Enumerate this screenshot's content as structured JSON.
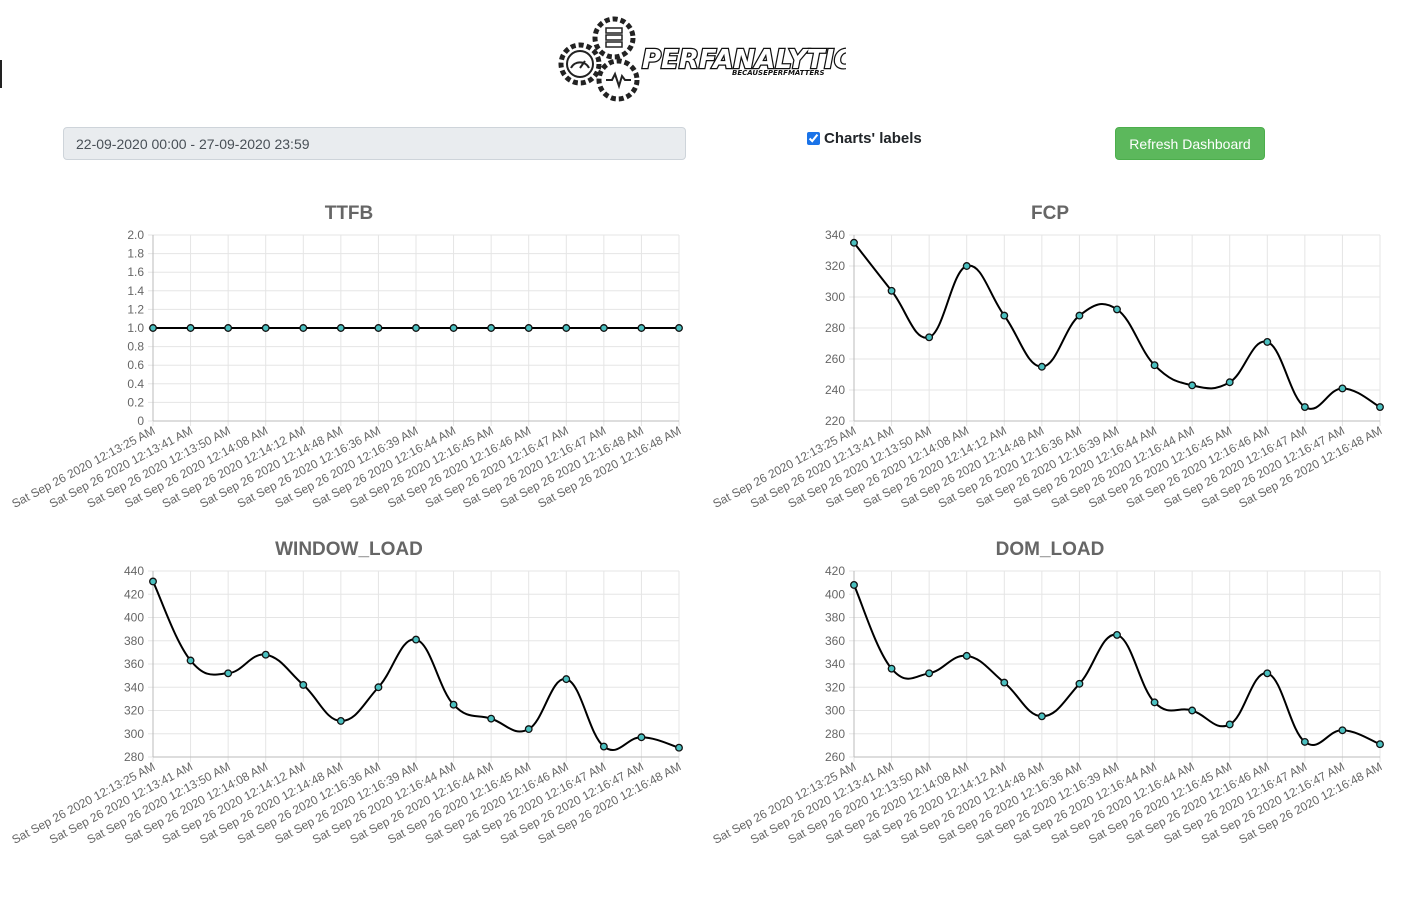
{
  "header": {
    "logo_text": "PERFANALYTICS",
    "logo_tagline": "BECAUSEPERFMATTERS"
  },
  "controls": {
    "date_range_value": "22-09-2020 00:00 - 27-09-2020 23:59",
    "labels_checkbox_label": "Charts' labels",
    "labels_checkbox_checked": true,
    "refresh_label": "Refresh Dashboard"
  },
  "colors": {
    "line": "#000000",
    "point_fill": "#4bc0c0",
    "grid": "#e5e5e5",
    "button_bg": "#5cb85c"
  },
  "chart_data": [
    {
      "type": "line",
      "title": "TTFB",
      "categories": [
        "Sat Sep 26 2020 12:13:25 AM",
        "Sat Sep 26 2020 12:13:41 AM",
        "Sat Sep 26 2020 12:13:50 AM",
        "Sat Sep 26 2020 12:14:08 AM",
        "Sat Sep 26 2020 12:14:12 AM",
        "Sat Sep 26 2020 12:14:48 AM",
        "Sat Sep 26 2020 12:16:36 AM",
        "Sat Sep 26 2020 12:16:39 AM",
        "Sat Sep 26 2020 12:16:44 AM",
        "Sat Sep 26 2020 12:16:45 AM",
        "Sat Sep 26 2020 12:16:46 AM",
        "Sat Sep 26 2020 12:16:47 AM",
        "Sat Sep 26 2020 12:16:47 AM",
        "Sat Sep 26 2020 12:16:48 AM",
        "Sat Sep 26 2020 12:16:48 AM"
      ],
      "values": [
        1,
        1,
        1,
        1,
        1,
        1,
        1,
        1,
        1,
        1,
        1,
        1,
        1,
        1,
        1
      ],
      "ylim": [
        0,
        2
      ],
      "yticks": [
        "0",
        "0.2",
        "0.4",
        "0.6",
        "0.8",
        "1.0",
        "1.2",
        "1.4",
        "1.6",
        "1.8",
        "2.0"
      ],
      "grid": true,
      "smooth": false
    },
    {
      "type": "line",
      "title": "FCP",
      "categories": [
        "Sat Sep 26 2020 12:13:25 AM",
        "Sat Sep 26 2020 12:13:41 AM",
        "Sat Sep 26 2020 12:13:50 AM",
        "Sat Sep 26 2020 12:14:08 AM",
        "Sat Sep 26 2020 12:14:12 AM",
        "Sat Sep 26 2020 12:14:48 AM",
        "Sat Sep 26 2020 12:16:36 AM",
        "Sat Sep 26 2020 12:16:39 AM",
        "Sat Sep 26 2020 12:16:44 AM",
        "Sat Sep 26 2020 12:16:44 AM",
        "Sat Sep 26 2020 12:16:45 AM",
        "Sat Sep 26 2020 12:16:46 AM",
        "Sat Sep 26 2020 12:16:47 AM",
        "Sat Sep 26 2020 12:16:47 AM",
        "Sat Sep 26 2020 12:16:48 AM"
      ],
      "values": [
        335,
        304,
        274,
        320,
        288,
        255,
        288,
        292,
        256,
        243,
        245,
        271,
        229,
        241,
        229
      ],
      "ylim": [
        220,
        340
      ],
      "yticks": [
        "220",
        "240",
        "260",
        "280",
        "300",
        "320",
        "340"
      ],
      "grid": true,
      "smooth": true
    },
    {
      "type": "line",
      "title": "WINDOW_LOAD",
      "categories": [
        "Sat Sep 26 2020 12:13:25 AM",
        "Sat Sep 26 2020 12:13:41 AM",
        "Sat Sep 26 2020 12:13:50 AM",
        "Sat Sep 26 2020 12:14:08 AM",
        "Sat Sep 26 2020 12:14:12 AM",
        "Sat Sep 26 2020 12:14:48 AM",
        "Sat Sep 26 2020 12:16:36 AM",
        "Sat Sep 26 2020 12:16:39 AM",
        "Sat Sep 26 2020 12:16:44 AM",
        "Sat Sep 26 2020 12:16:44 AM",
        "Sat Sep 26 2020 12:16:45 AM",
        "Sat Sep 26 2020 12:16:46 AM",
        "Sat Sep 26 2020 12:16:47 AM",
        "Sat Sep 26 2020 12:16:47 AM",
        "Sat Sep 26 2020 12:16:48 AM"
      ],
      "values": [
        431,
        363,
        352,
        368,
        342,
        311,
        340,
        381,
        325,
        313,
        304,
        347,
        289,
        297,
        288
      ],
      "ylim": [
        280,
        440
      ],
      "yticks": [
        "280",
        "300",
        "320",
        "340",
        "360",
        "380",
        "400",
        "420",
        "440"
      ],
      "grid": true,
      "smooth": true
    },
    {
      "type": "line",
      "title": "DOM_LOAD",
      "categories": [
        "Sat Sep 26 2020 12:13:25 AM",
        "Sat Sep 26 2020 12:13:41 AM",
        "Sat Sep 26 2020 12:13:50 AM",
        "Sat Sep 26 2020 12:14:08 AM",
        "Sat Sep 26 2020 12:14:12 AM",
        "Sat Sep 26 2020 12:14:48 AM",
        "Sat Sep 26 2020 12:16:36 AM",
        "Sat Sep 26 2020 12:16:39 AM",
        "Sat Sep 26 2020 12:16:44 AM",
        "Sat Sep 26 2020 12:16:44 AM",
        "Sat Sep 26 2020 12:16:45 AM",
        "Sat Sep 26 2020 12:16:46 AM",
        "Sat Sep 26 2020 12:16:47 AM",
        "Sat Sep 26 2020 12:16:47 AM",
        "Sat Sep 26 2020 12:16:48 AM"
      ],
      "values": [
        408,
        336,
        332,
        347,
        324,
        295,
        323,
        365,
        307,
        300,
        288,
        332,
        273,
        283,
        271
      ],
      "ylim": [
        260,
        420
      ],
      "yticks": [
        "260",
        "280",
        "300",
        "320",
        "340",
        "360",
        "380",
        "400",
        "420"
      ],
      "grid": true,
      "smooth": true
    }
  ]
}
